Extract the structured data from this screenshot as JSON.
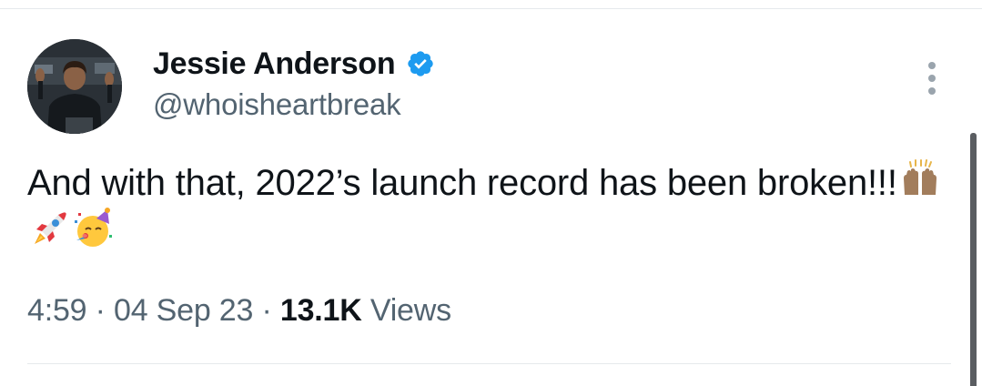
{
  "author": {
    "display_name": "Jessie Anderson",
    "handle": "@whoisheartbreak",
    "verified": true,
    "avatar_icon": "profile-photo-icon"
  },
  "tweet": {
    "text": "And with that, 2022’s launch record has been broken!!!",
    "emojis": [
      "raising-hands-icon",
      "rocket-icon",
      "partying-face-icon"
    ]
  },
  "meta": {
    "time": "4:59",
    "separator": "·",
    "date": "04 Sep 23",
    "views_count": "13.1K",
    "views_label": "Views"
  },
  "colors": {
    "text_primary": "#0f1419",
    "text_secondary": "#536471",
    "verified_blue": "#1d9bf0",
    "divider": "#e6e9ec"
  },
  "icons": {
    "more": "more-options-icon",
    "verified": "verified-badge-icon"
  }
}
